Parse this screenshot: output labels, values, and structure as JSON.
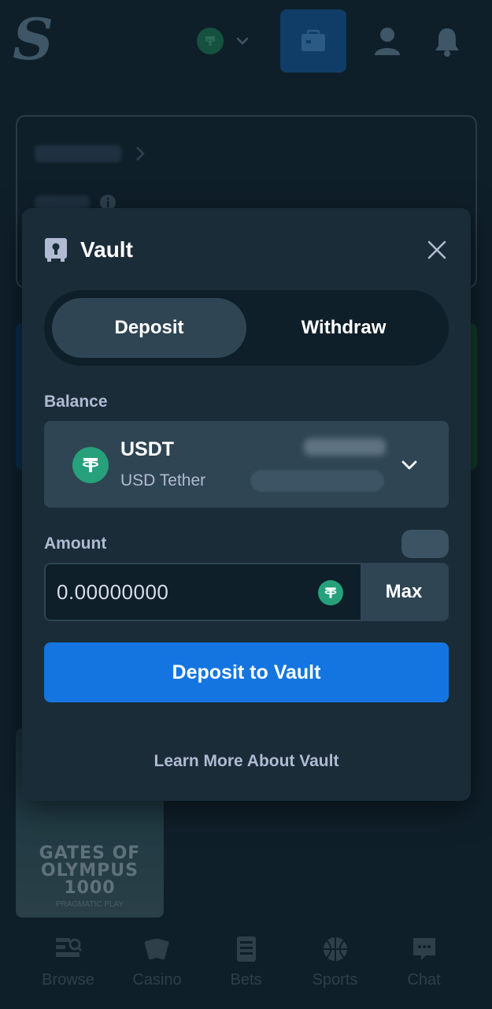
{
  "topbar": {
    "logo_text": "S",
    "currency_coin_glyph": "₮",
    "icons": [
      "logo",
      "tether-coin-icon",
      "chevron-down-icon",
      "wallet-icon",
      "user-icon",
      "bell-icon"
    ]
  },
  "background": {
    "game_tile": {
      "title_line1": "GATES OF",
      "title_line2": "OLYMPUS",
      "title_line3": "1000",
      "subtitle": "PRAGMATIC PLAY"
    }
  },
  "bottom_nav": {
    "items": [
      {
        "label": "Browse",
        "icon": "browse-icon"
      },
      {
        "label": "Casino",
        "icon": "casino-cards-icon"
      },
      {
        "label": "Bets",
        "icon": "bets-slip-icon"
      },
      {
        "label": "Sports",
        "icon": "basketball-icon"
      },
      {
        "label": "Chat",
        "icon": "chat-icon"
      }
    ]
  },
  "modal": {
    "title": "Vault",
    "tabs": [
      {
        "label": "Deposit",
        "active": true
      },
      {
        "label": "Withdraw",
        "active": false
      }
    ],
    "balance_label": "Balance",
    "currency": {
      "code": "USDT",
      "name": "USD Tether",
      "glyph": "₮"
    },
    "amount_label": "Amount",
    "amount_value": "0.00000000",
    "max_label": "Max",
    "submit_label": "Deposit to Vault",
    "learn_more": "Learn More About Vault"
  },
  "colors": {
    "page_bg": "#0f1f29",
    "modal_bg": "#1a2c38",
    "surface": "#2f4553",
    "primary_button": "#1475e1",
    "tether_green": "#26a17b",
    "muted_text": "#b1bad3"
  }
}
